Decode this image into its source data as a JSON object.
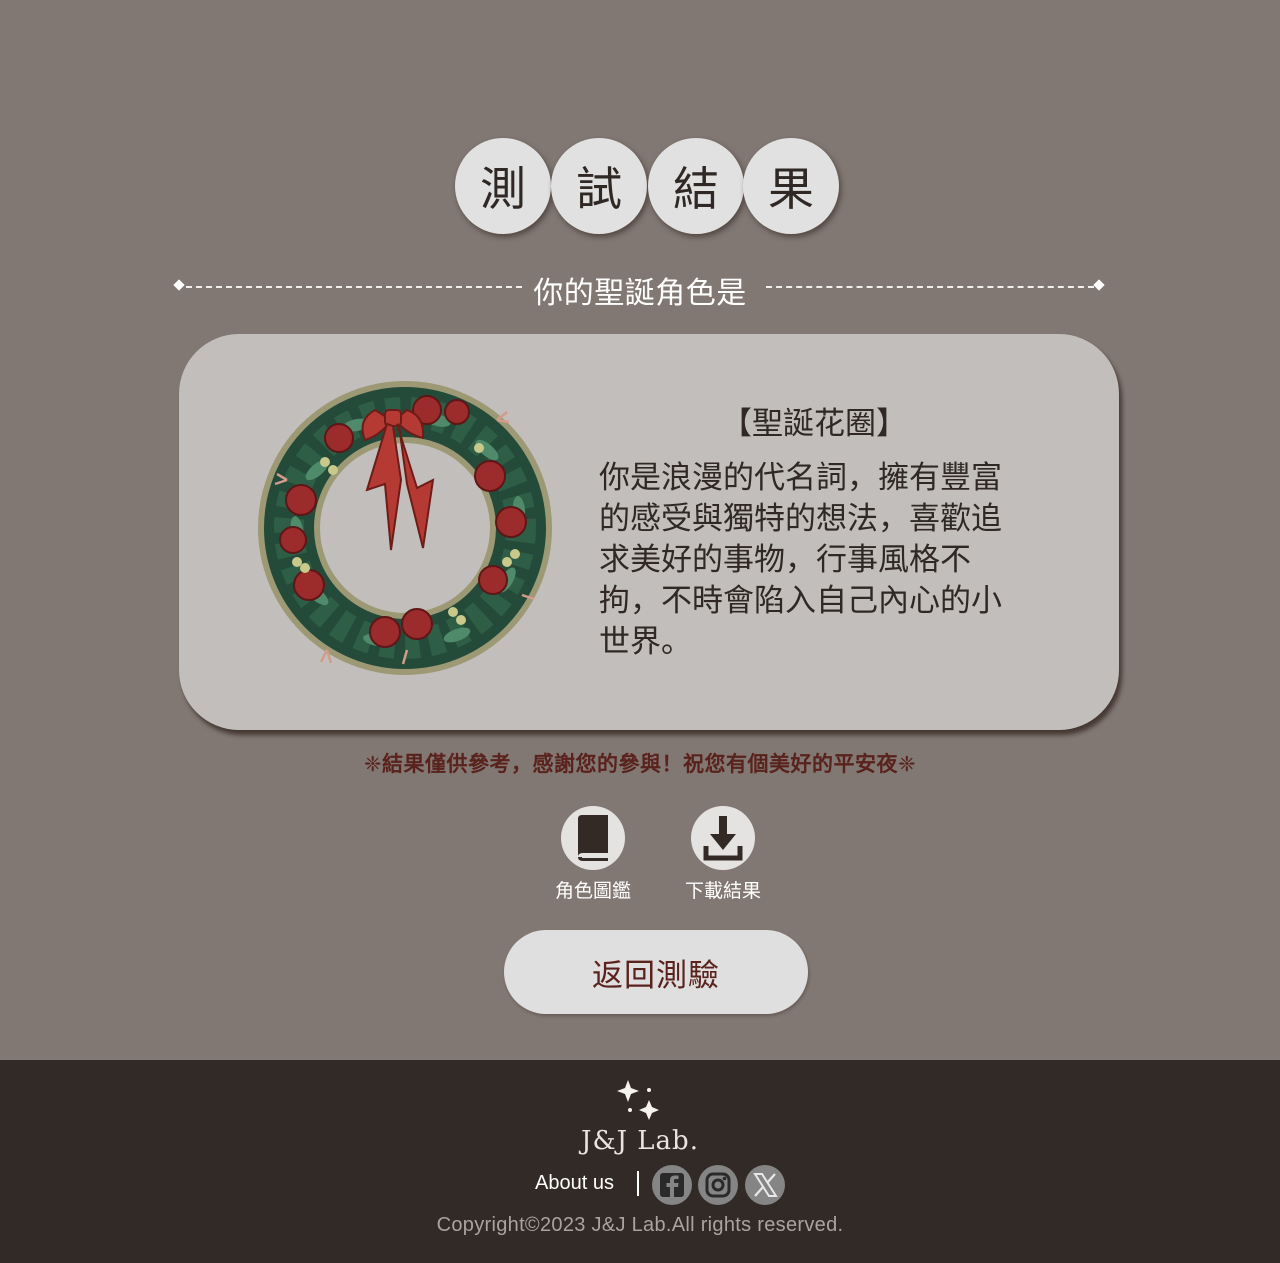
{
  "header": {
    "title_chars": [
      "測",
      "試",
      "結",
      "果"
    ],
    "subtitle": "你的聖誕角色是"
  },
  "result": {
    "name": "【聖誕花圈】",
    "description": "你是浪漫的代名詞，擁有豐富的感受與獨特的想法，喜歡追求美好的事物，行事風格不拘，不時會陷入自己內心的小世界。",
    "image_icon": "christmas-wreath-illustration"
  },
  "note": "❈結果僅供參考，感謝您的參與！祝您有個美好的平安夜❈",
  "actions": [
    {
      "label": "角色圖鑑",
      "icon": "book-icon"
    },
    {
      "label": "下載結果",
      "icon": "download-icon"
    }
  ],
  "back_button": "返回測驗",
  "footer": {
    "logo": "J&J Lab.",
    "about": "About us",
    "social": [
      "facebook-icon",
      "instagram-icon",
      "x-icon"
    ],
    "copyright": "Copyright©2023 J&J Lab.All rights reserved."
  },
  "colors": {
    "background": "#827873",
    "card": "#c2bebb",
    "footer": "#322a26",
    "accent": "#5a221c",
    "circle": "#e2e1e1"
  }
}
